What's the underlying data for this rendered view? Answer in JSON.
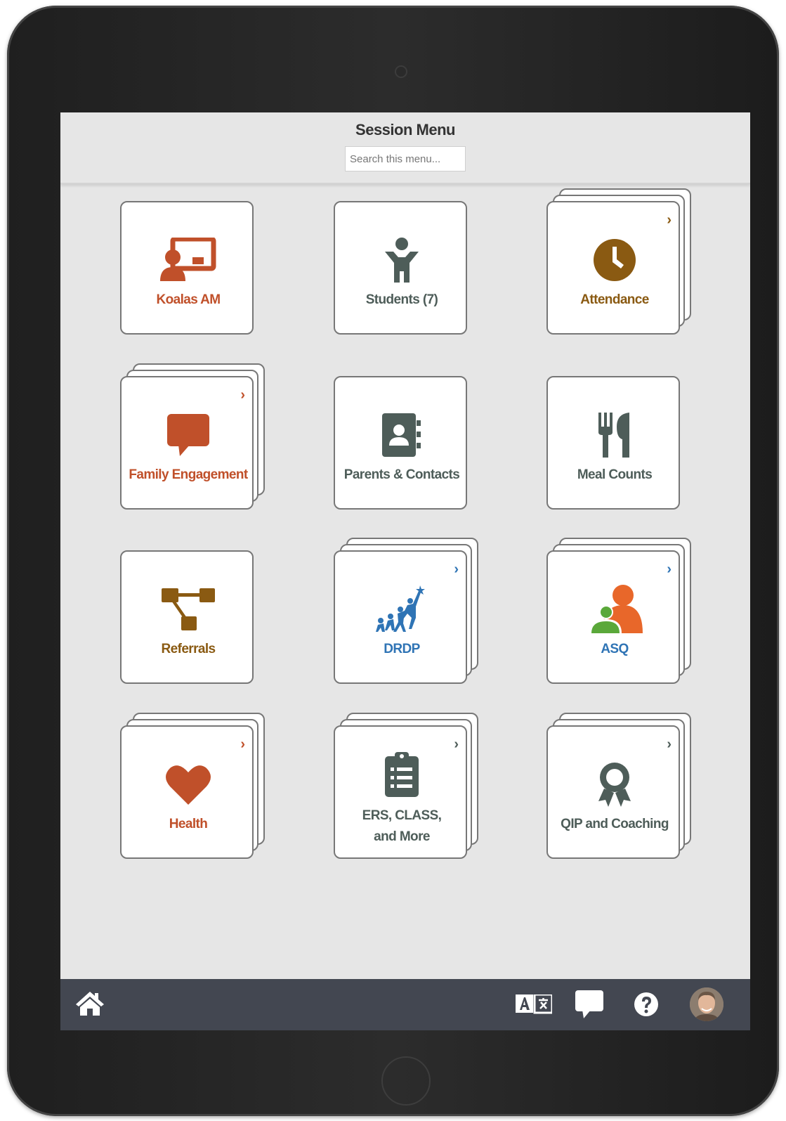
{
  "header": {
    "title": "Session Menu",
    "search_placeholder": "Search this menu..."
  },
  "tiles": [
    {
      "label": "Koalas AM",
      "stacked": false,
      "icon": "classroom-icon",
      "color": "#c0502a"
    },
    {
      "label": "Students (7)",
      "stacked": false,
      "icon": "child-icon",
      "color": "#4e5d59"
    },
    {
      "label": "Attendance",
      "stacked": true,
      "icon": "clock-icon",
      "color": "#8a5a12",
      "chevron": "›",
      "chevron_color": "#8a5a12"
    },
    {
      "label": "Family Engagement",
      "stacked": true,
      "icon": "speech-bubble-icon",
      "color": "#c0502a",
      "chevron": "›",
      "chevron_color": "#c0502a"
    },
    {
      "label": "Parents & Contacts",
      "stacked": false,
      "icon": "address-book-icon",
      "color": "#4e5d59"
    },
    {
      "label": "Meal Counts",
      "stacked": false,
      "icon": "fork-knife-icon",
      "color": "#4e5d59"
    },
    {
      "label": "Referrals",
      "stacked": false,
      "icon": "sitemap-icon",
      "color": "#8a5a12"
    },
    {
      "label": "DRDP",
      "stacked": true,
      "icon": "drdp-logo-icon",
      "color": "#2f74b5",
      "chevron": "›",
      "chevron_color": "#2f74b5"
    },
    {
      "label": "ASQ",
      "stacked": true,
      "icon": "asq-logo-icon",
      "color": "#2f74b5",
      "chevron": "›",
      "chevron_color": "#2f74b5"
    },
    {
      "label": "Health",
      "stacked": true,
      "icon": "heart-icon",
      "color": "#c0502a",
      "chevron": "›",
      "chevron_color": "#c0502a"
    },
    {
      "label": "ERS, CLASS, and More",
      "stacked": true,
      "icon": "clipboard-list-icon",
      "color": "#4e5d59",
      "chevron": "›",
      "chevron_color": "#4e5d59"
    },
    {
      "label": "QIP and Coaching",
      "stacked": true,
      "icon": "award-ribbon-icon",
      "color": "#4e5d59",
      "chevron": "›",
      "chevron_color": "#4e5d59"
    }
  ],
  "footer": {
    "icons": [
      "home-icon",
      "translate-icon",
      "chat-icon",
      "help-icon",
      "avatar"
    ]
  }
}
